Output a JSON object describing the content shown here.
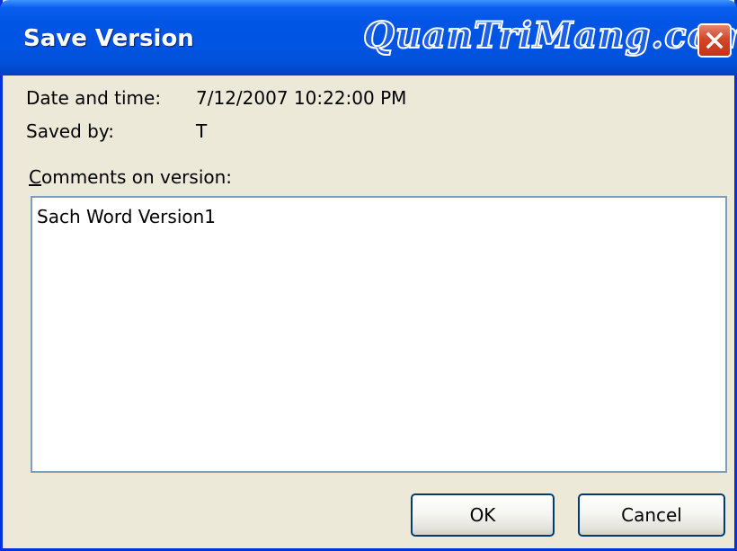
{
  "dialog": {
    "title": "Save Version",
    "watermark": "QuanTriMang.com",
    "close_icon": "close-icon",
    "date_label": "Date and time:",
    "date_value": "7/12/2007 10:22:00 PM",
    "saved_by_label": "Saved by:",
    "saved_by_value": "T",
    "comments_label_mnemonic": "C",
    "comments_label_rest": "omments on version:",
    "comments_value": "Sach Word Version1",
    "ok_label": "OK",
    "cancel_label": "Cancel"
  },
  "colors": {
    "titlebar": "#0054e3",
    "dialog_background": "#ece9d8",
    "close_button": "#d2462a",
    "textbox_border": "#7f9db9",
    "button_border": "#003c74"
  }
}
